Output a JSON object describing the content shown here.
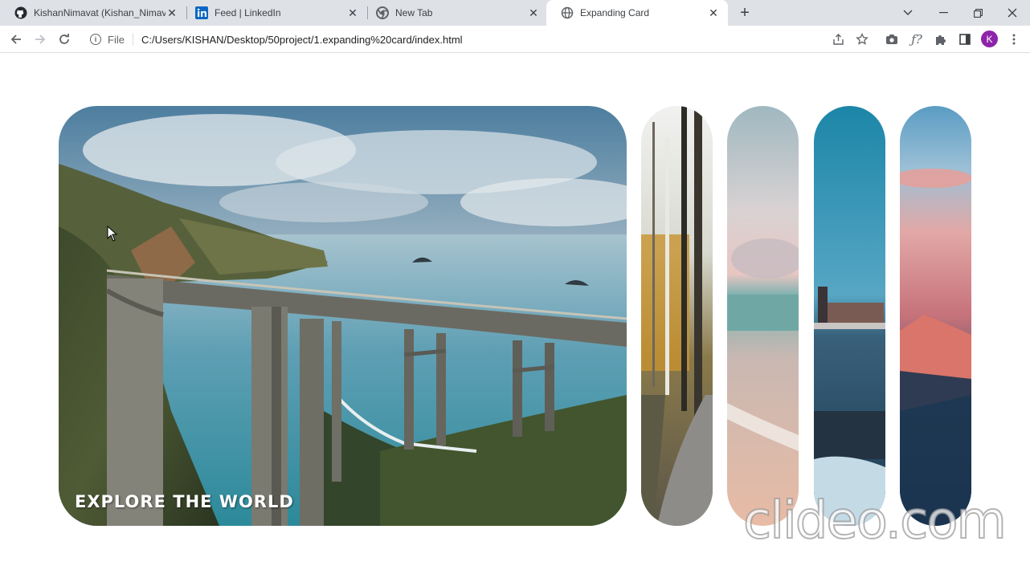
{
  "browser": {
    "tabs": [
      {
        "label": "KishanNimavat (Kishan_Nimavat)",
        "icon": "github-icon"
      },
      {
        "label": "Feed | LinkedIn",
        "icon": "linkedin-icon"
      },
      {
        "label": "New Tab",
        "icon": "chrome-icon"
      },
      {
        "label": "Expanding Card",
        "icon": "globe-icon",
        "active": true
      }
    ],
    "address": {
      "scheme_label": "File",
      "url": "C:/Users/KISHAN/Desktop/50project/1.expanding%20card/index.html"
    },
    "profile_initial": "K"
  },
  "page": {
    "panels": [
      {
        "title": "EXPLORE THE WORLD",
        "active": true,
        "scene": "coastal-bridge"
      },
      {
        "title": "",
        "active": false,
        "scene": "autumn-forest"
      },
      {
        "title": "",
        "active": false,
        "scene": "beach-sunset"
      },
      {
        "title": "",
        "active": false,
        "scene": "city-lake"
      },
      {
        "title": "",
        "active": false,
        "scene": "mountain-sunset"
      }
    ]
  },
  "watermark": "clideo.com",
  "colors": {
    "tab_strip": "#dee1e6",
    "profile": "#8e24aa"
  }
}
